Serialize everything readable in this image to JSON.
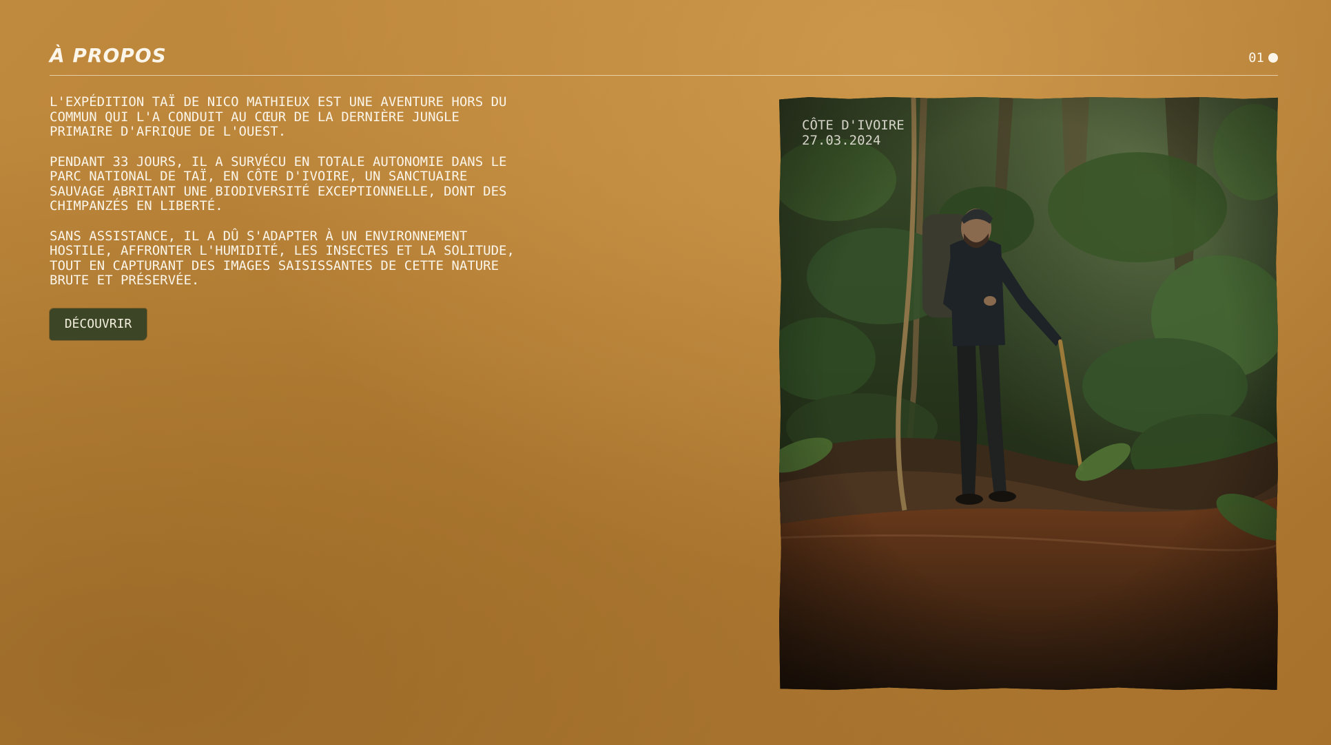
{
  "header": {
    "title": "À PROPOS",
    "page_number": "01"
  },
  "intro": {
    "paragraphs": [
      "L'EXPÉDITION TAÏ DE NICO MATHIEUX EST UNE AVENTURE HORS DU\nCOMMUN QUI L'A CONDUIT AU CŒUR DE LA DERNIÈRE JUNGLE\nPRIMAIRE D'AFRIQUE DE L'OUEST.",
      "PENDANT 33 JOURS, IL A SURVÉCU EN TOTALE AUTONOMIE DANS LE\nPARC NATIONAL DE TAÏ, EN CÔTE D'IVOIRE, UN SANCTUAIRE\nSAUVAGE ABRITANT UNE BIODIVERSITÉ EXCEPTIONNELLE, DONT DES\nCHIMPANZÉS EN LIBERTÉ.",
      "SANS ASSISTANCE, IL A DÛ S'ADAPTER À UN ENVIRONNEMENT\nHOSTILE, AFFRONTER L'HUMIDITÉ, LES INSECTES ET LA SOLITUDE,\nTOUT EN CAPTURANT DES IMAGES SAISISSANTES DE CETTE NATURE\nBRUTE ET PRÉSERVÉE."
    ],
    "cta_label": "DÉCOUVRIR"
  },
  "photo": {
    "location": "CÔTE D'IVOIRE",
    "date": "27.03.2024"
  },
  "colors": {
    "background": "#b98237",
    "text": "#fbf5ea",
    "button": "#3c4525",
    "jungle_dark": "#1e2616",
    "water": "#4a2a14"
  }
}
